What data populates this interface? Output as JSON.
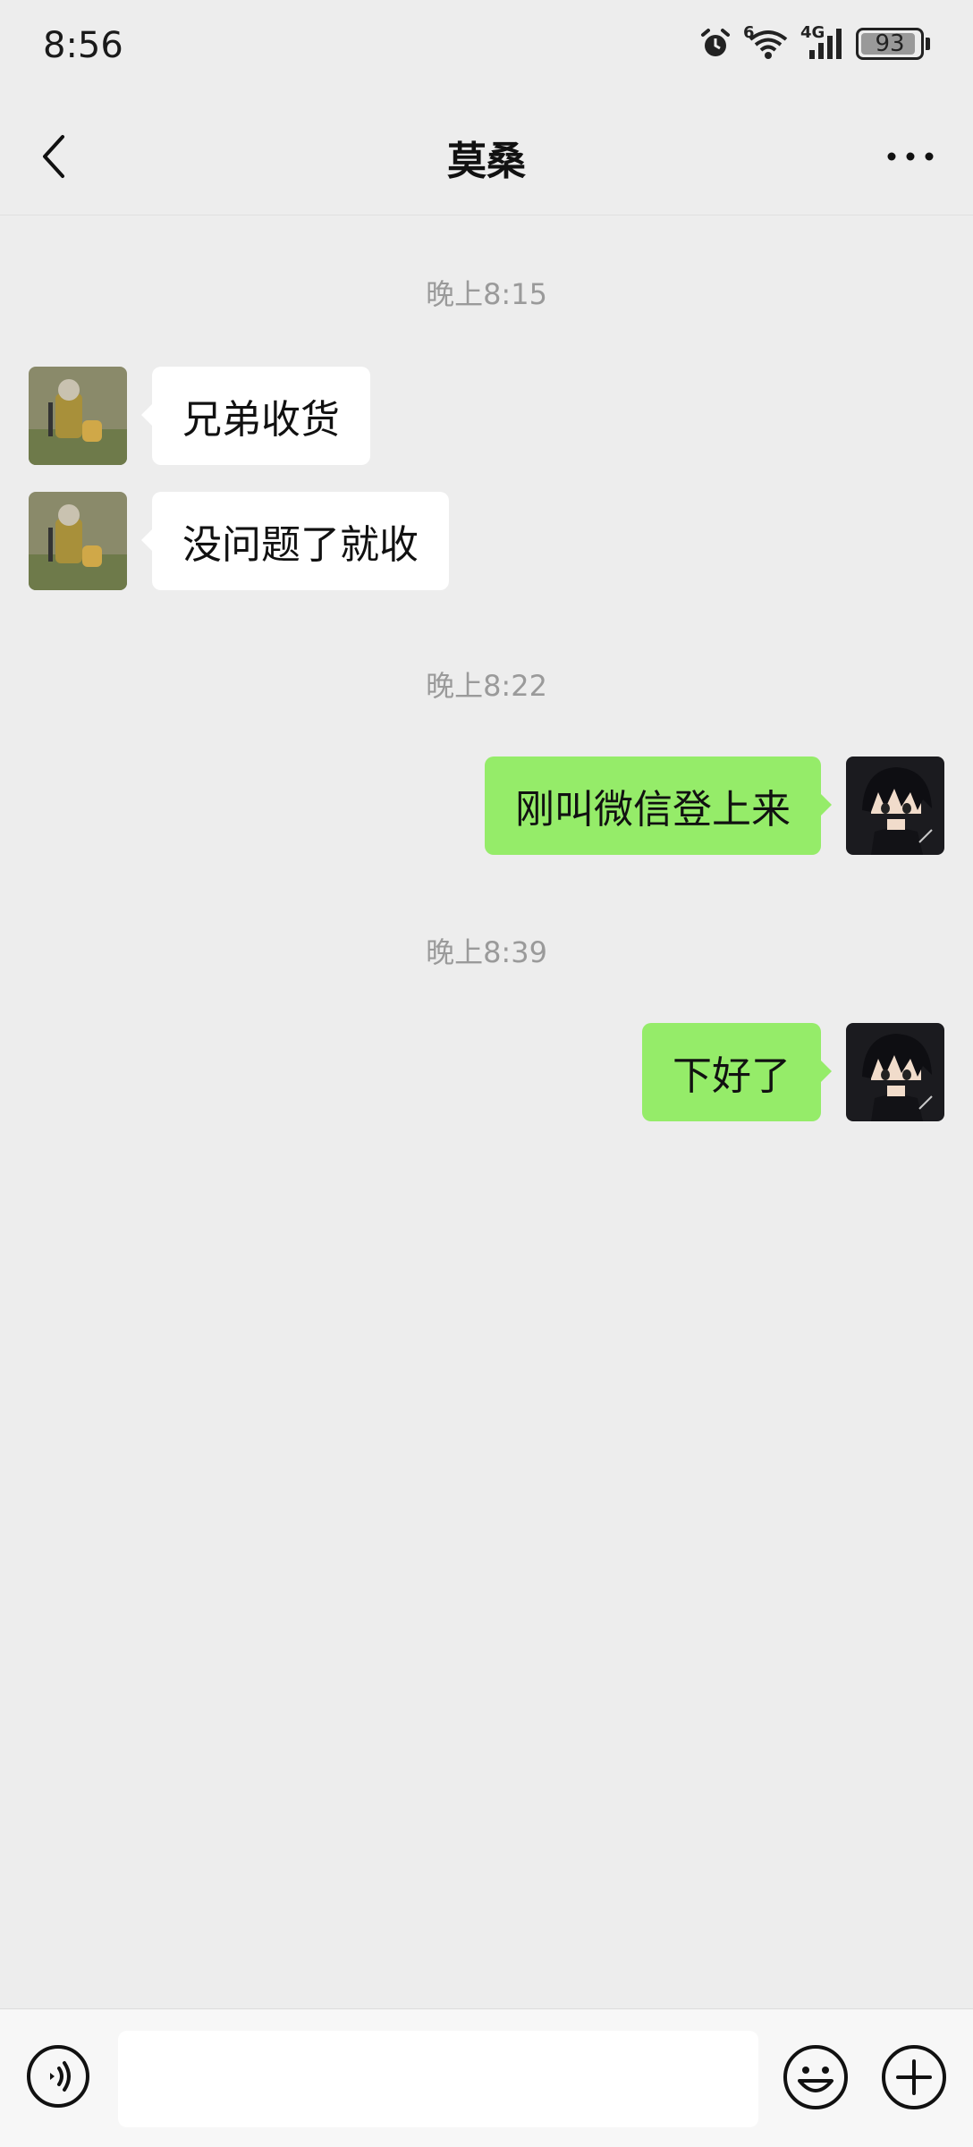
{
  "status_bar": {
    "time": "8:56",
    "wifi_label": "6",
    "network": "4G",
    "battery": "93"
  },
  "header": {
    "title": "莫桑"
  },
  "messages": [
    {
      "type": "time",
      "text": "晚上8:15"
    },
    {
      "type": "incoming",
      "text": "兄弟收货"
    },
    {
      "type": "incoming",
      "text": "没问题了就收"
    },
    {
      "type": "time",
      "text": "晚上8:22"
    },
    {
      "type": "outgoing",
      "text": "刚叫微信登上来"
    },
    {
      "type": "time",
      "text": "晚上8:39"
    },
    {
      "type": "outgoing",
      "text": "下好了"
    }
  ],
  "input_bar": {
    "value": "",
    "icons": [
      "voice-icon",
      "emoji-icon",
      "plus-icon"
    ]
  },
  "colors": {
    "background": "#ededed",
    "outgoing_bubble": "#95ec69",
    "incoming_bubble": "#ffffff",
    "timestamp_text": "#9a9a9a"
  }
}
